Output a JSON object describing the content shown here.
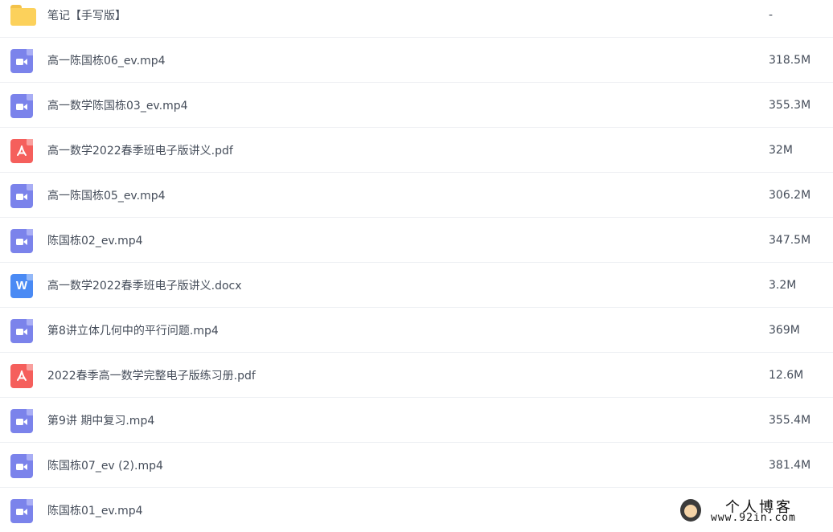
{
  "files": [
    {
      "type": "folder",
      "icon": "folder-icon",
      "name": "笔记【手写版】",
      "size": "-"
    },
    {
      "type": "video",
      "icon": "video-file-icon",
      "name": "高一陈国栋06_ev.mp4",
      "size": "318.5M"
    },
    {
      "type": "video",
      "icon": "video-file-icon",
      "name": "高一数学陈国栋03_ev.mp4",
      "size": "355.3M"
    },
    {
      "type": "pdf",
      "icon": "pdf-file-icon",
      "name": "高一数学2022春季班电子版讲义.pdf",
      "size": "32M"
    },
    {
      "type": "video",
      "icon": "video-file-icon",
      "name": "高一陈国栋05_ev.mp4",
      "size": "306.2M"
    },
    {
      "type": "video",
      "icon": "video-file-icon",
      "name": "陈国栋02_ev.mp4",
      "size": "347.5M"
    },
    {
      "type": "word",
      "icon": "word-file-icon",
      "name": "高一数学2022春季班电子版讲义.docx",
      "size": "3.2M"
    },
    {
      "type": "video",
      "icon": "video-file-icon",
      "name": "第8讲立体几何中的平行问题.mp4",
      "size": "369M"
    },
    {
      "type": "pdf",
      "icon": "pdf-file-icon",
      "name": "2022春季高一数学完整电子版练习册.pdf",
      "size": "12.6M"
    },
    {
      "type": "video",
      "icon": "video-file-icon",
      "name": "第9讲 期中复习.mp4",
      "size": "355.4M"
    },
    {
      "type": "video",
      "icon": "video-file-icon",
      "name": "陈国栋07_ev (2).mp4",
      "size": "381.4M"
    },
    {
      "type": "video",
      "icon": "video-file-icon",
      "name": "陈国栋01_ev.mp4",
      "size": ""
    }
  ],
  "word_icon_letter": "W",
  "watermark": {
    "title": "个人博客",
    "url": "www.92in.com"
  },
  "colors": {
    "video": "#7b83eb",
    "pdf": "#f55f5c",
    "word": "#4a8af4",
    "folder": "#fcd15b",
    "text": "#454d5a"
  }
}
